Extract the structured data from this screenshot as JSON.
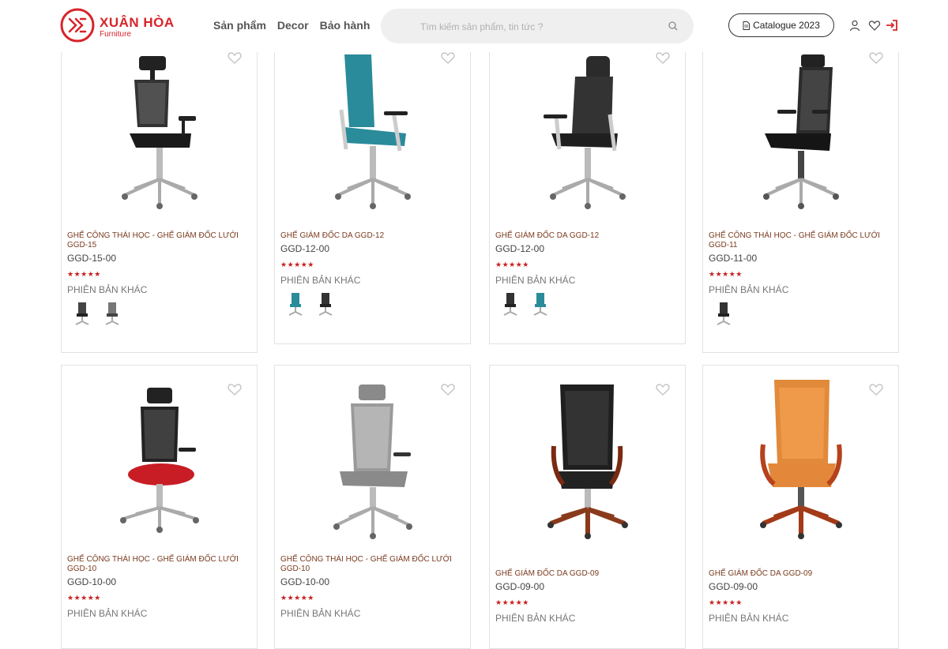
{
  "brand": {
    "name": "XUÂN HÒA",
    "sub": "Furniture"
  },
  "nav": [
    "Sản phẩm",
    "Decor",
    "Bảo hành"
  ],
  "search": {
    "placeholder": "Tìm kiếm sản phẩm, tin tức ?"
  },
  "catalogue_label": "Catalogue 2023",
  "colors": {
    "brand": "#d7242a",
    "stars": "#c82020",
    "card_border": "#e2e2e2"
  },
  "variants_label": "Phiên bản khác",
  "stars": "★★★★★",
  "row1": [
    {
      "name": "GHẾ CÔNG THÁI HỌC - GHẾ GIÁM ĐỐC LƯỚI GGD-15",
      "code": "GGD-15-00",
      "thumbs": [
        "gray",
        "gray"
      ]
    },
    {
      "name": "GHẾ GIÁM ĐỐC DA GGD-12",
      "code": "GGD-12-00",
      "thumbs": [
        "teal",
        "dark"
      ]
    },
    {
      "name": "GHẾ GIÁM ĐỐC DA GGD-12",
      "code": "GGD-12-00",
      "thumbs": [
        "dark",
        "teal"
      ]
    },
    {
      "name": "GHẾ CÔNG THÁI HỌC - GHẾ GIÁM ĐỐC LƯỚI GGD-11",
      "code": "GGD-11-00",
      "thumbs": [
        "dark"
      ]
    }
  ],
  "row2": [
    {
      "name": "GHẾ CÔNG THÁI HỌC - GHẾ GIÁM ĐỐC LƯỚI GGD-10",
      "code": "GGD-10-00"
    },
    {
      "name": "GHẾ CÔNG THÁI HỌC - GHẾ GIÁM ĐỐC LƯỚI GGD-10",
      "code": "GGD-10-00"
    },
    {
      "name": "GHẾ GIÁM ĐỐC DA GGD-09",
      "code": "GGD-09-00"
    },
    {
      "name": "GHẾ GIÁM ĐỐC DA GGD-09",
      "code": "GGD-09-00"
    }
  ]
}
